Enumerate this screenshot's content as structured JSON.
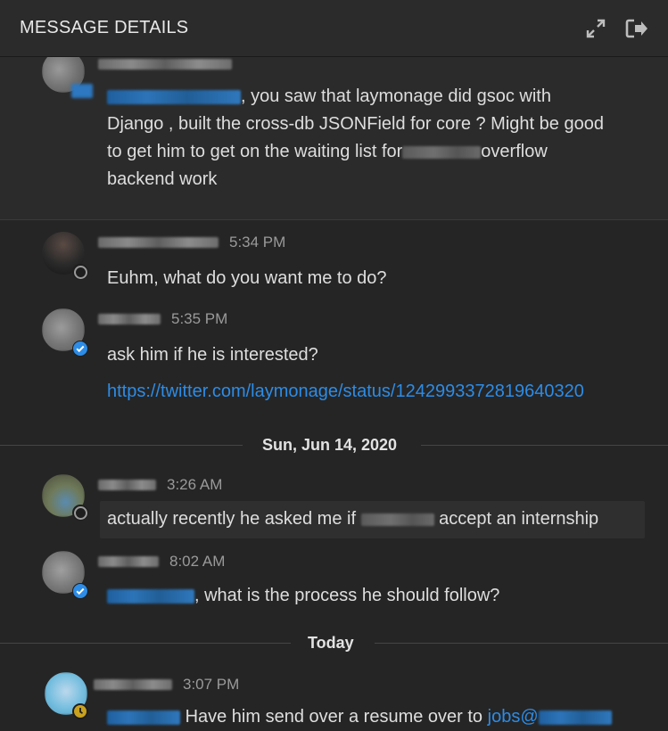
{
  "header": {
    "title": "MESSAGE DETAILS",
    "expand_icon": "expand-arrows-icon",
    "exit_icon": "exit-icon"
  },
  "messages": {
    "m0": {
      "text_1": ", you saw that laymonage did gsoc with",
      "text_2": "Django , built the cross-db JSONField for core ?  Might be good",
      "text_3": "to get him to get on the waiting list for",
      "text_3b": "overflow",
      "text_4": "backend work"
    },
    "m1": {
      "time": "5:34 PM",
      "text": "Euhm, what do you want me to do?"
    },
    "m2": {
      "time": "5:35 PM",
      "text": "ask him if he is interested?",
      "link": "https://twitter.com/laymonage/status/1242993372819640320"
    },
    "m3": {
      "time": "3:26 AM",
      "text_a": "actually recently he asked me if",
      "text_b": "accept an internship"
    },
    "m4": {
      "time": "8:02 AM",
      "text": ", what is the process he should follow?"
    },
    "m5": {
      "time": "3:07 PM",
      "text": "Have him send over a resume over to",
      "link": "jobs@"
    }
  },
  "dividers": {
    "d1": "Sun, Jun 14, 2020",
    "d2": "Today"
  },
  "colors": {
    "background": "#252525",
    "link": "#2d8ce6",
    "verified": "#2d8ce6"
  }
}
